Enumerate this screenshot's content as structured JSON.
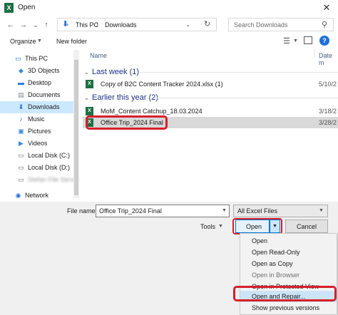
{
  "window": {
    "title": "Open",
    "app_icon": "X"
  },
  "nav": {
    "back": "←",
    "forward": "→",
    "up_menu": "⌄",
    "up": "↑",
    "breadcrumb": [
      "This PC",
      "Downloads"
    ],
    "refresh": "↻",
    "search_placeholder": "Search Downloads"
  },
  "toolbar": {
    "organize": "Organize",
    "new_folder": "New folder"
  },
  "sidebar": {
    "items": [
      {
        "label": "This PC",
        "icon": "pc-icon"
      },
      {
        "label": "3D Objects",
        "icon": "3d-objects-icon"
      },
      {
        "label": "Desktop",
        "icon": "desktop-icon"
      },
      {
        "label": "Documents",
        "icon": "documents-icon"
      },
      {
        "label": "Downloads",
        "icon": "downloads-icon"
      },
      {
        "label": "Music",
        "icon": "music-icon"
      },
      {
        "label": "Pictures",
        "icon": "pictures-icon"
      },
      {
        "label": "Videos",
        "icon": "videos-icon"
      },
      {
        "label": "Local Disk (C:)",
        "icon": "disk-icon"
      },
      {
        "label": "Local Disk (D:)",
        "icon": "disk-icon"
      },
      {
        "label": "Stefan File Server",
        "icon": "network-drive-icon"
      },
      {
        "label": "Network",
        "icon": "network-icon"
      }
    ]
  },
  "columns": {
    "name": "Name",
    "date": "Date m"
  },
  "groups": [
    {
      "header": "Last week (1)",
      "files": [
        {
          "name": "Copy of B2C Content Tracker 2024.xlsx (1)",
          "date": "5/10/2"
        }
      ]
    },
    {
      "header": "Earlier this year (2)",
      "files": [
        {
          "name": "MoM_Content Catchup_18.03.2024",
          "date": "3/18/2"
        },
        {
          "name": "Office Trip_2024 Final",
          "date": "3/28/2"
        }
      ]
    }
  ],
  "bottom": {
    "file_name_label": "File name:",
    "file_name_value": "Office Trip_2024 Final",
    "file_type": "All Excel Files",
    "tools": "Tools",
    "open": "Open",
    "cancel": "Cancel"
  },
  "open_menu": [
    {
      "label": "Open",
      "enabled": true
    },
    {
      "label": "Open Read-Only",
      "enabled": true
    },
    {
      "label": "Open as Copy",
      "enabled": true
    },
    {
      "label": "Open in Browser",
      "enabled": false
    },
    {
      "label": "Open in Protected View",
      "enabled": true
    },
    {
      "label": "Open and Repair...",
      "enabled": true
    },
    {
      "label": "Show previous versions",
      "enabled": true
    }
  ],
  "colors": {
    "accent": "#0078d7",
    "highlight_red": "#d6202b",
    "excel_green": "#1d6f42",
    "group_header": "#1e3287"
  }
}
